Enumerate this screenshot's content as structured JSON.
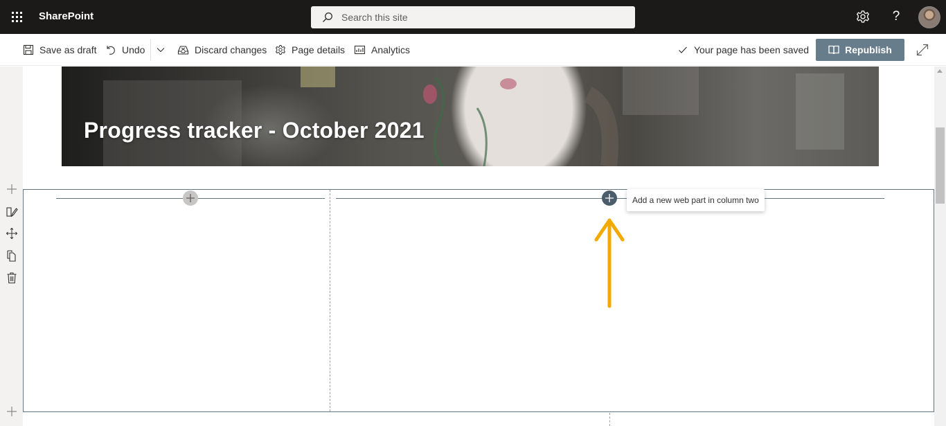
{
  "suite_bar": {
    "app_name": "SharePoint",
    "search_placeholder": "Search this site",
    "icons": [
      "app-launcher-icon",
      "settings-gear-icon",
      "help-icon",
      "user-avatar"
    ]
  },
  "command_bar": {
    "save_as_draft": "Save as draft",
    "undo": "Undo",
    "discard_changes": "Discard changes",
    "page_details": "Page details",
    "analytics": "Analytics",
    "status": "Your page has been saved",
    "republish": "Republish"
  },
  "page": {
    "title": "Progress tracker - October 2021"
  },
  "section": {
    "tooltip": "Add a new web part in column two"
  },
  "colors": {
    "suite_bar_bg": "#1b1a19",
    "republish_bg": "#677d8b",
    "section_border": "#627785",
    "annotation_arrow": "#f2a900"
  }
}
